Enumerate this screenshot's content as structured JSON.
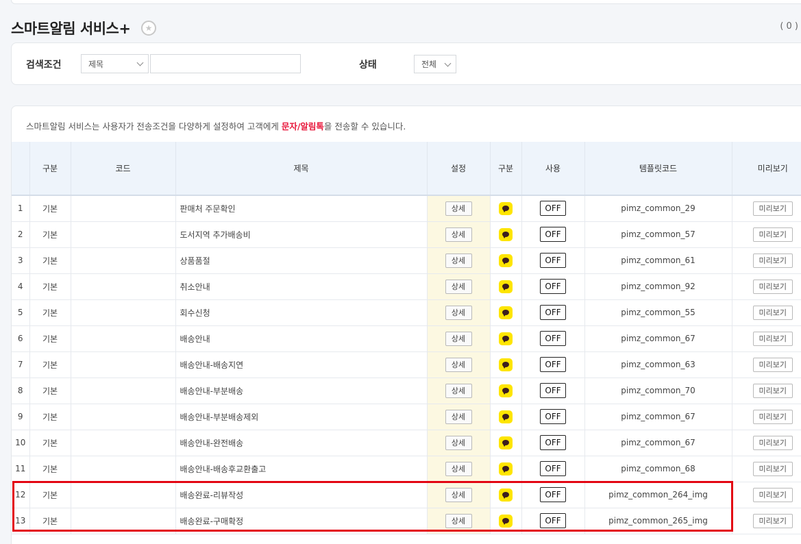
{
  "header": {
    "title": "스마트알림 서비스+",
    "count": "( 0 )"
  },
  "search": {
    "condition_label": "검색조건",
    "field_select": "제목",
    "keyword_value": "",
    "status_label": "상태",
    "status_select": "전체"
  },
  "notice": {
    "before": "스마트알림 서비스는 사용자가 전송조건을 다양하게 설정하여 고객에게 ",
    "highlight": "문자/알림톡",
    "after": "을 전송할 수 있습니다."
  },
  "table": {
    "headers": [
      "",
      "구분",
      "코드",
      "제목",
      "설정",
      "구분",
      "사용",
      "템플릿코드",
      "미리보기"
    ],
    "rows": [
      {
        "no": "1",
        "type": "기본",
        "code": "",
        "title": "판매처 주문확인",
        "setting": "상세",
        "use": "OFF",
        "template": "pimz_common_29",
        "preview": "미리보기"
      },
      {
        "no": "2",
        "type": "기본",
        "code": "",
        "title": "도서지역 추가배송비",
        "setting": "상세",
        "use": "OFF",
        "template": "pimz_common_57",
        "preview": "미리보기"
      },
      {
        "no": "3",
        "type": "기본",
        "code": "",
        "title": "상품품절",
        "setting": "상세",
        "use": "OFF",
        "template": "pimz_common_61",
        "preview": "미리보기"
      },
      {
        "no": "4",
        "type": "기본",
        "code": "",
        "title": "취소안내",
        "setting": "상세",
        "use": "OFF",
        "template": "pimz_common_92",
        "preview": "미리보기"
      },
      {
        "no": "5",
        "type": "기본",
        "code": "",
        "title": "회수신청",
        "setting": "상세",
        "use": "OFF",
        "template": "pimz_common_55",
        "preview": "미리보기"
      },
      {
        "no": "6",
        "type": "기본",
        "code": "",
        "title": "배송안내",
        "setting": "상세",
        "use": "OFF",
        "template": "pimz_common_67",
        "preview": "미리보기"
      },
      {
        "no": "7",
        "type": "기본",
        "code": "",
        "title": "배송안내-배송지연",
        "setting": "상세",
        "use": "OFF",
        "template": "pimz_common_63",
        "preview": "미리보기"
      },
      {
        "no": "8",
        "type": "기본",
        "code": "",
        "title": "배송안내-부분배송",
        "setting": "상세",
        "use": "OFF",
        "template": "pimz_common_70",
        "preview": "미리보기"
      },
      {
        "no": "9",
        "type": "기본",
        "code": "",
        "title": "배송안내-부분배송제외",
        "setting": "상세",
        "use": "OFF",
        "template": "pimz_common_67",
        "preview": "미리보기"
      },
      {
        "no": "10",
        "type": "기본",
        "code": "",
        "title": "배송안내-완전배송",
        "setting": "상세",
        "use": "OFF",
        "template": "pimz_common_67",
        "preview": "미리보기"
      },
      {
        "no": "11",
        "type": "기본",
        "code": "",
        "title": "배송안내-배송후교환출고",
        "setting": "상세",
        "use": "OFF",
        "template": "pimz_common_68",
        "preview": "미리보기"
      },
      {
        "no": "12",
        "type": "기본",
        "code": "",
        "title": "배송완료-리뷰작성",
        "setting": "상세",
        "use": "OFF",
        "template": "pimz_common_264_img",
        "preview": "미리보기"
      },
      {
        "no": "13",
        "type": "기본",
        "code": "",
        "title": "배송완료-구매확정",
        "setting": "상세",
        "use": "OFF",
        "template": "pimz_common_265_img",
        "preview": "미리보기"
      }
    ]
  },
  "icons": {
    "favorite": "star-icon",
    "channel": "kakaotalk-icon",
    "dropdown": "chevron-down-icon"
  },
  "colors": {
    "notice_highlight": "#e8173b",
    "kakao_yellow": "#fee500",
    "annotation_box": "#e30613"
  }
}
